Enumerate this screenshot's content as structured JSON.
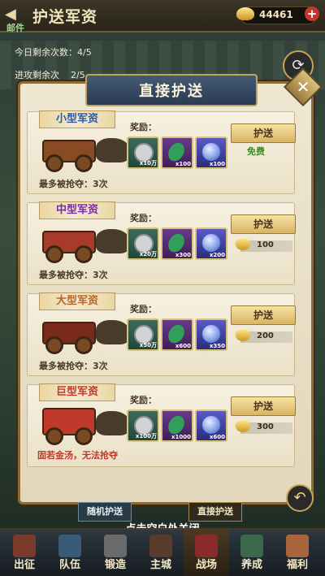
{
  "header": {
    "title": "护送军资",
    "mail": "邮件",
    "gold": "44461"
  },
  "info": {
    "daily_label": "今日剩余次数：",
    "daily_value": "4/5",
    "attack_label": "进攻剩余次",
    "attack_value": "2/5",
    "refresh_label": "刷"
  },
  "dialog": {
    "title": "直接护送",
    "cards": [
      {
        "name": "小型军资",
        "name_color": "#2a5aa8",
        "max_rob": "最多被抢夺：3次",
        "reward_label": "奖励：",
        "items": [
          {
            "type": "coin",
            "qty": "x10万"
          },
          {
            "type": "jade",
            "qty": "x100"
          },
          {
            "type": "orb",
            "qty": "x100"
          }
        ],
        "button": "护送",
        "free": "免费"
      },
      {
        "name": "中型军资",
        "name_color": "#7a2aa8",
        "max_rob": "最多被抢夺：3次",
        "reward_label": "奖励：",
        "items": [
          {
            "type": "coin",
            "qty": "x20万"
          },
          {
            "type": "jade",
            "qty": "x300"
          },
          {
            "type": "orb",
            "qty": "x200"
          }
        ],
        "button": "护送",
        "cost": "100"
      },
      {
        "name": "大型军资",
        "name_color": "#b8642a",
        "max_rob": "最多被抢夺：3次",
        "reward_label": "奖励：",
        "items": [
          {
            "type": "coin",
            "qty": "x50万"
          },
          {
            "type": "jade",
            "qty": "x600"
          },
          {
            "type": "orb",
            "qty": "x350"
          }
        ],
        "button": "护送",
        "cost": "200"
      },
      {
        "name": "巨型军资",
        "name_color": "#c0392b",
        "warning": "固若金汤，无法抢夺",
        "reward_label": "奖励：",
        "items": [
          {
            "type": "coin",
            "qty": "x100万"
          },
          {
            "type": "jade",
            "qty": "x1000"
          },
          {
            "type": "orb",
            "qty": "x600"
          }
        ],
        "button": "护送",
        "cost": "300"
      }
    ]
  },
  "tabs": {
    "random": "随机护送",
    "direct": "直接护送"
  },
  "hint": "点击空白处关闭",
  "nav": [
    "出征",
    "队伍",
    "锻造",
    "主城",
    "战场",
    "养成",
    "福利"
  ]
}
